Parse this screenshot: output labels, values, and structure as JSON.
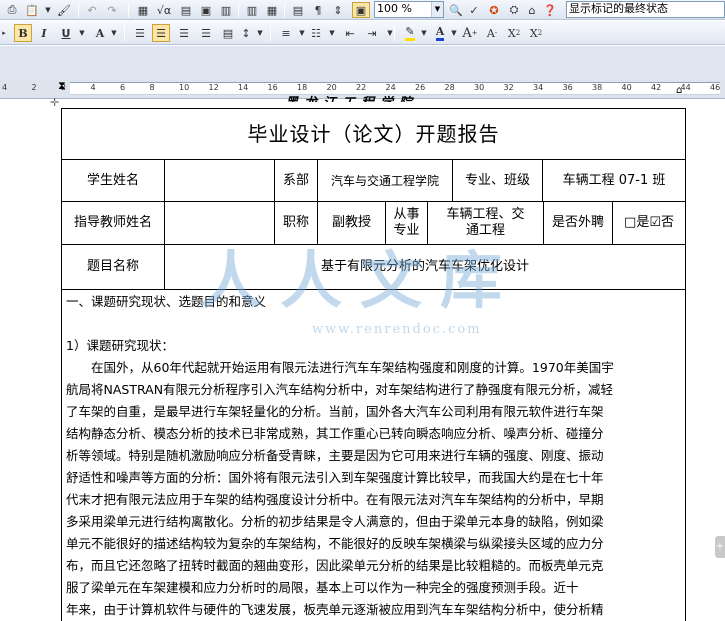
{
  "toolbar1": {
    "zoom": "100 %",
    "show_markup": "显示标记的最终状态"
  },
  "toolbar2": {
    "bold": "B",
    "italic": "I",
    "underline": "U",
    "font_color": "A",
    "highlight_color": "#ffe000",
    "text_color": "#1a3fd6",
    "grow": "A",
    "shrink": "A",
    "superscript": "X",
    "subscript": "X"
  },
  "ruler": {
    "numbers": [
      "4",
      "2",
      "2",
      "4",
      "6",
      "8",
      "10",
      "12",
      "14",
      "16",
      "18",
      "20",
      "22",
      "24",
      "26",
      "28",
      "30",
      "32",
      "34",
      "36",
      "38",
      "40",
      "42",
      "44",
      "46"
    ]
  },
  "doc": {
    "header_script": "黑龙江工程学院",
    "title": "毕业设计（论文）开题报告",
    "row1": {
      "label1": "学生姓名",
      "label2": "系部",
      "value2": "汽车与交通工程学院",
      "label3": "专业、班级",
      "value3": "车辆工程 07-1 班"
    },
    "row2": {
      "label1": "指导教师姓名",
      "label2": "职称",
      "value2": "副教授",
      "label3": "从事专业",
      "value3": "车辆工程、交通工程",
      "label4": "是否外聘",
      "value4": "□是☑否"
    },
    "row3": {
      "label": "题目名称",
      "value": "基于有限元分析的汽车车架优化设计"
    },
    "section_title": "一、课题研究现状、选题目的和意义",
    "subsection": "1）课题研究现状：",
    "paragraph_lines": [
      "　　在国外，从60年代起就开始运用有限元法进行汽车车架结构强度和刚度的计算。1970年美国宇",
      "航局将NASTRAN有限元分析程序引入汽车结构分析中，对车架结构进行了静强度有限元分析，减轻",
      "了车架的自重，是最早进行车架轻量化的分析。当前，国外各大汽车公司利用有限元软件进行车架",
      "结构静态分析、模态分析的技术已非常成熟，其工作重心已转向瞬态响应分析、噪声分析、碰撞分",
      "析等领域。特别是随机激励响应分析备受青睐，主要是因为它可用来进行车辆的强度、刚度、振动",
      "舒适性和噪声等方面的分析：国外将有限元法引入到车架强度计算比较早，而我国大约是在七十年",
      "代末才把有限元法应用于车架的结构强度设计分析中。在有限元法对汽车车架结构的分析中，早期",
      "多采用梁单元进行结构离散化。分析的初步结果是令人满意的，但由于梁单元本身的缺陷，例如梁",
      "单元不能很好的描述结构较为复杂的车架结构，不能很好的反映车架横梁与纵梁接头区域的应力分",
      "布，而且它还忽略了扭转时截面的翘曲变形，因此梁单元分析的结果是比较粗糙的。而板壳单元克",
      "服了梁单元在车架建模和应力分析时的局限，基本上可以作为一种完全的强度预测手段。近十",
      "年来，由于计算机软件与硬件的飞速发展，板壳单元逐渐被应用到汽车车架结构分析中，使分析精"
    ],
    "watermark": "人人文库",
    "watermark_url": "www.renrendoc.com"
  }
}
